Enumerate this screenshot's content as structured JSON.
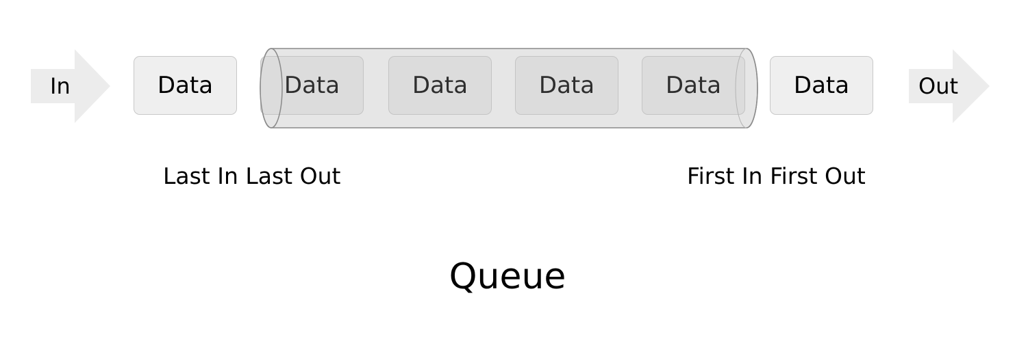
{
  "diagram": {
    "title": "Queue",
    "in_label": "In",
    "out_label": "Out",
    "left_caption": "Last In Last Out",
    "right_caption": "First In First Out",
    "items": [
      {
        "label": "Data"
      },
      {
        "label": "Data"
      },
      {
        "label": "Data"
      },
      {
        "label": "Data"
      },
      {
        "label": "Data"
      },
      {
        "label": "Data"
      }
    ]
  },
  "colors": {
    "arrow_fill": "#ececec",
    "box_fill": "#efefef",
    "inner_box_fill": "#dcdcdc",
    "tube_fill": "#e6e6e6",
    "tube_stroke": "#8a8a8a"
  }
}
